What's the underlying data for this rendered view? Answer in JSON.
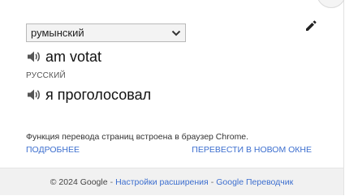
{
  "header": {
    "source_language": "румынский",
    "edit_icon": "pencil-icon"
  },
  "source": {
    "speaker_icon": "speaker-icon",
    "text": "am votat"
  },
  "target": {
    "language_label": "РУССКИЙ",
    "speaker_icon": "speaker-icon",
    "text": "я проголосовал"
  },
  "info": {
    "text": "Функция перевода страниц встроена в браузер Chrome.",
    "more_link": "ПОДРОБНЕЕ",
    "new_window_link": "ПЕРЕВЕСТИ В НОВОМ ОКНЕ"
  },
  "footer": {
    "copyright": "© 2024 Google",
    "separator": "-",
    "settings_link": "Настройки расширения",
    "translator_link": "Google Переводчик"
  },
  "colors": {
    "link": "#3d6fcf",
    "footer_bg": "#f1f1f1",
    "select_bg": "#f3f3f3"
  }
}
